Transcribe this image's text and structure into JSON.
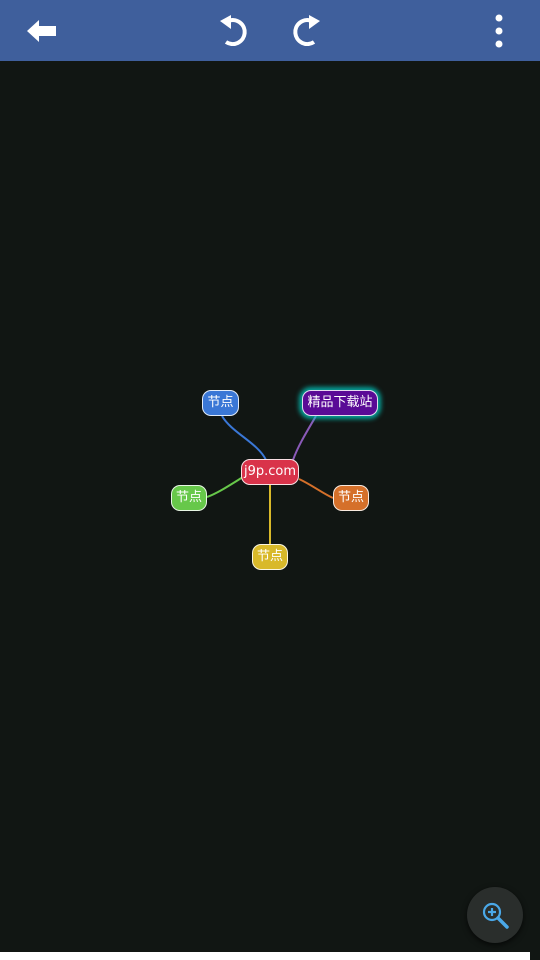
{
  "toolbar": {
    "background": "#3f5f9c",
    "back_icon": "arrow-left-icon",
    "undo_icon": "undo-icon",
    "redo_icon": "redo-icon",
    "more_icon": "more-vert-icon"
  },
  "mindmap": {
    "root": {
      "label": "j9p.com",
      "color": "#d9334a"
    },
    "children": [
      {
        "label": "节点",
        "color": "#3a77d6"
      },
      {
        "label": "精品下载站",
        "color": "#5a0a96",
        "selected": true
      },
      {
        "label": "节点",
        "color": "#67c84a"
      },
      {
        "label": "节点",
        "color": "#d5702a"
      },
      {
        "label": "节点",
        "color": "#d9b92a"
      }
    ]
  },
  "zoom": {
    "icon": "zoom-in-icon"
  }
}
